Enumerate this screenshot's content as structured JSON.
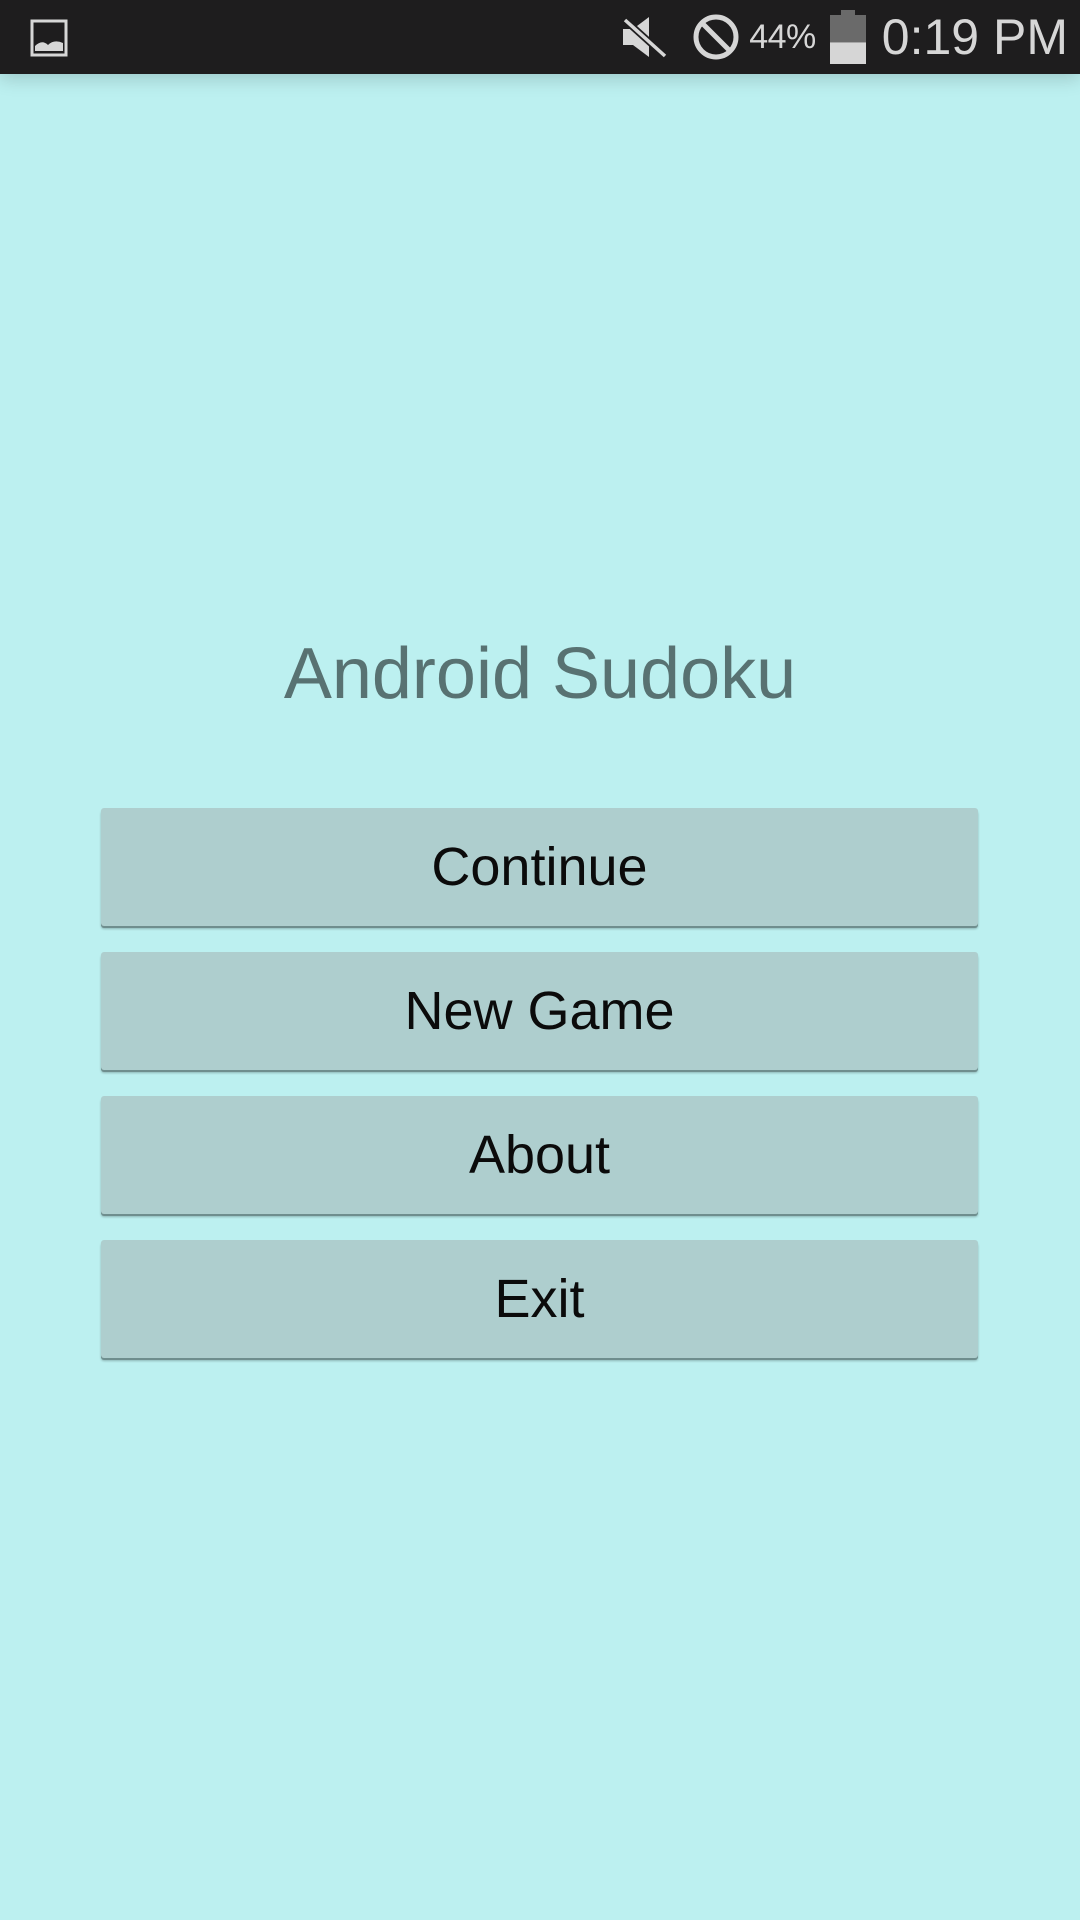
{
  "status_bar": {
    "left_icon": "gallery-icon",
    "icons": [
      "mute-icon",
      "do-not-disturb-icon",
      "battery-icon"
    ],
    "battery_percent": "44%",
    "battery_level": 0.44,
    "time": "0:19 PM",
    "background": "#1e1d1e",
    "icon_color": "#d6d6d6"
  },
  "app": {
    "title": "Android Sudoku",
    "background": "#bcf0f0",
    "title_color": "#587272"
  },
  "menu": {
    "button_color": "#aecece",
    "buttons": [
      {
        "label": "Continue"
      },
      {
        "label": "New Game"
      },
      {
        "label": "About"
      },
      {
        "label": "Exit"
      }
    ]
  }
}
